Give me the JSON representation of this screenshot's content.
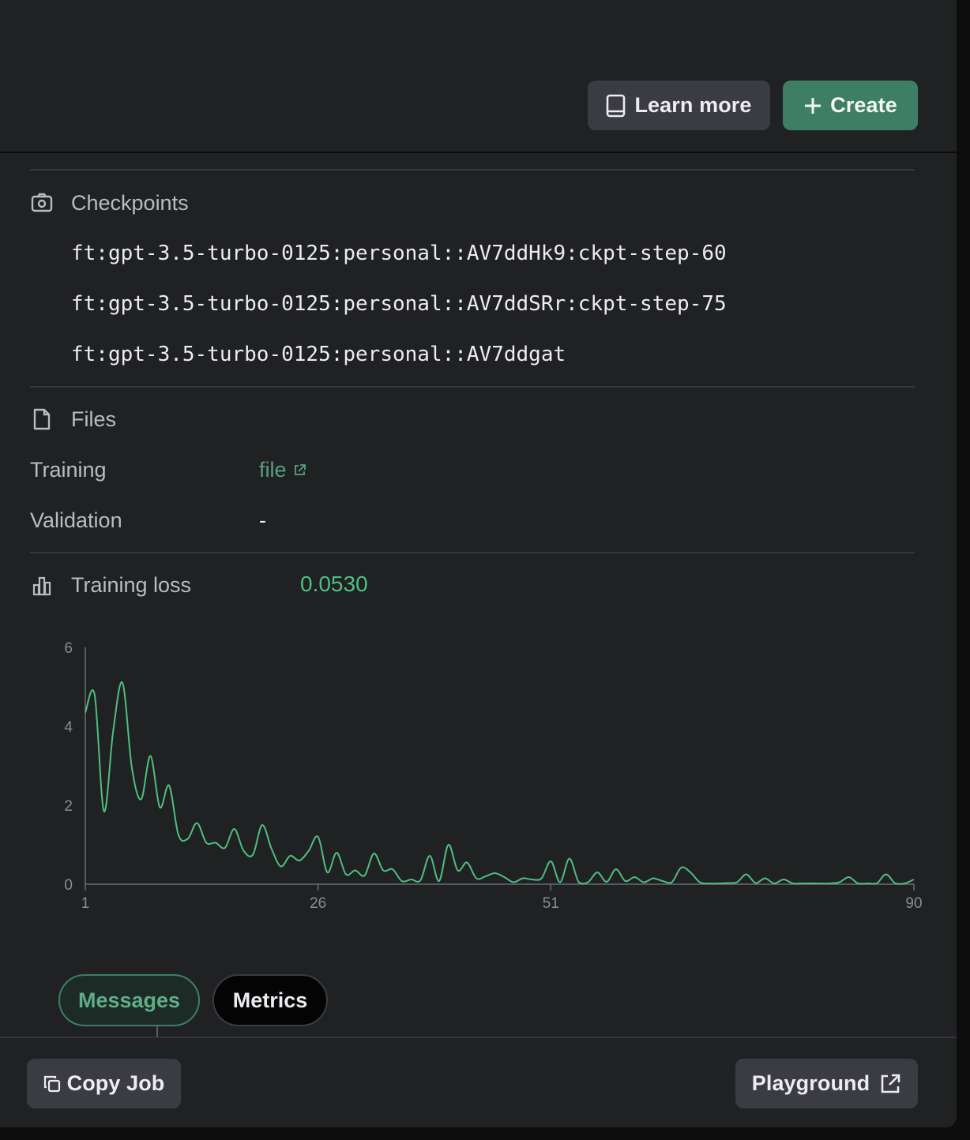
{
  "header": {
    "learn_more_label": "Learn more",
    "create_label": "Create",
    "learn_more_icon": "book-icon",
    "create_icon": "plus-icon"
  },
  "checkpoints": {
    "title": "Checkpoints",
    "icon": "camera-icon",
    "items": [
      "ft:gpt-3.5-turbo-0125:personal::AV7ddHk9:ckpt-step-60",
      "ft:gpt-3.5-turbo-0125:personal::AV7ddSRr:ckpt-step-75",
      "ft:gpt-3.5-turbo-0125:personal::AV7ddgat"
    ]
  },
  "files": {
    "title": "Files",
    "icon": "file-icon",
    "training_label": "Training",
    "training_value": "file",
    "validation_label": "Validation",
    "validation_value": "-"
  },
  "loss": {
    "title": "Training loss",
    "icon": "bar-chart-icon",
    "value": "0.0530"
  },
  "chart_data": {
    "type": "line",
    "x_ticks": [
      "1",
      "26",
      "51",
      "90"
    ],
    "y_ticks": [
      "0",
      "2",
      "4",
      "6"
    ],
    "xlim": [
      1,
      90
    ],
    "ylim": [
      0,
      6
    ],
    "grid": false,
    "color": "#4fbf7f",
    "x": [
      1,
      2,
      3,
      4,
      5,
      6,
      7,
      8,
      9,
      10,
      11,
      12,
      13,
      14,
      15,
      16,
      17,
      18,
      19,
      20,
      21,
      22,
      23,
      24,
      25,
      26,
      27,
      28,
      29,
      30,
      31,
      32,
      33,
      34,
      35,
      36,
      37,
      38,
      39,
      40,
      41,
      42,
      43,
      44,
      45,
      46,
      47,
      48,
      49,
      50,
      51,
      52,
      53,
      54,
      55,
      56,
      57,
      58,
      59,
      60,
      61,
      62,
      63,
      64,
      65,
      66,
      67,
      68,
      69,
      70,
      71,
      72,
      73,
      74,
      75,
      76,
      77,
      78,
      79,
      80,
      81,
      82,
      83,
      84,
      85,
      86,
      87,
      88,
      89,
      90
    ],
    "y": [
      4.35,
      4.8,
      1.85,
      3.9,
      5.1,
      2.95,
      2.15,
      3.25,
      1.95,
      2.5,
      1.25,
      1.15,
      1.55,
      1.05,
      1.05,
      0.92,
      1.4,
      0.85,
      0.75,
      1.5,
      0.9,
      0.45,
      0.72,
      0.6,
      0.85,
      1.2,
      0.3,
      0.8,
      0.25,
      0.35,
      0.22,
      0.78,
      0.35,
      0.38,
      0.08,
      0.12,
      0.1,
      0.72,
      0.08,
      1.0,
      0.35,
      0.55,
      0.15,
      0.2,
      0.28,
      0.18,
      0.05,
      0.15,
      0.12,
      0.15,
      0.58,
      0.05,
      0.65,
      0.05,
      0.05,
      0.3,
      0.06,
      0.38,
      0.08,
      0.18,
      0.05,
      0.15,
      0.08,
      0.05,
      0.42,
      0.3,
      0.05,
      0.02,
      0.02,
      0.03,
      0.05,
      0.25,
      0.03,
      0.15,
      0.02,
      0.12,
      0.02,
      0.02,
      0.02,
      0.02,
      0.02,
      0.05,
      0.18,
      0.02,
      0.02,
      0.02,
      0.25,
      0.02,
      0.02,
      0.12
    ]
  },
  "tabs": {
    "messages_label": "Messages",
    "metrics_label": "Metrics"
  },
  "footer": {
    "copy_job_label": "Copy Job",
    "playground_label": "Playground",
    "copy_icon": "copy-icon",
    "playground_icon": "external-link-icon"
  }
}
